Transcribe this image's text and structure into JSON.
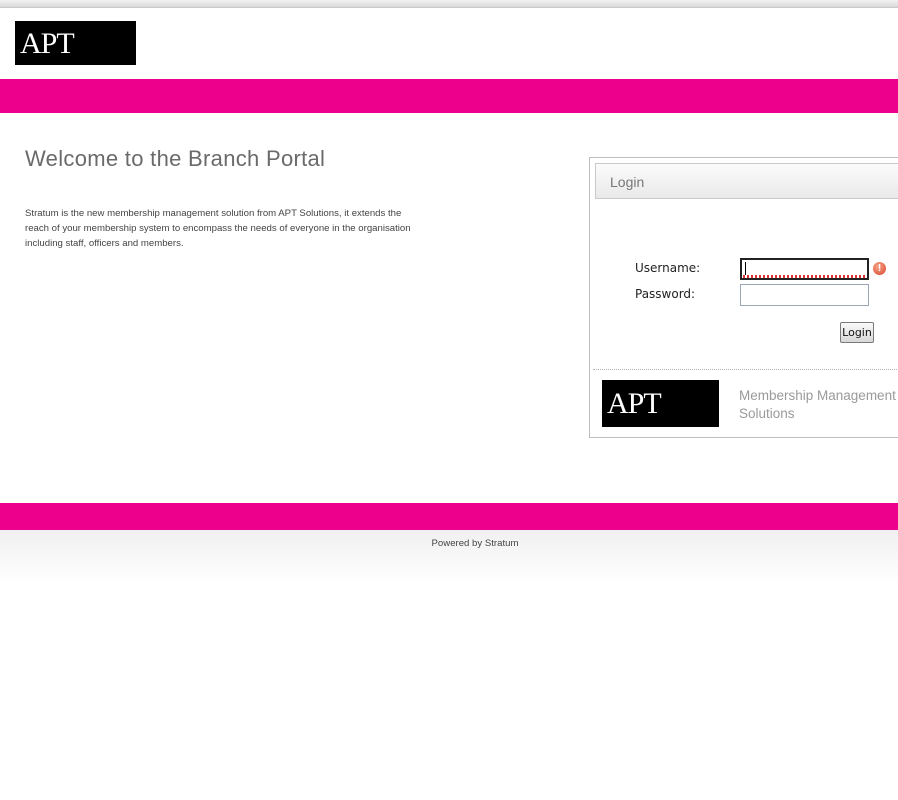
{
  "header": {
    "logo_text": "APT"
  },
  "main": {
    "title": "Welcome to the Branch Portal",
    "intro": "Stratum is the new membership management solution from APT Solutions, it extends the reach of your membership system to encompass the needs of everyone in the organisation including staff, officers and members."
  },
  "login": {
    "title": "Login",
    "username_label": "Username:",
    "username_value": "",
    "password_label": "Password:",
    "password_value": "",
    "button_label": "Login",
    "error_glyph": "!",
    "footer_logo_text": "APT",
    "tagline_line1": "Membership Management",
    "tagline_line2": "Solutions"
  },
  "footer": {
    "powered_by": "Powered by Stratum"
  },
  "colors": {
    "brand_pink": "#ec008c",
    "logo_bg": "#000000",
    "error_red": "#d9432a"
  }
}
